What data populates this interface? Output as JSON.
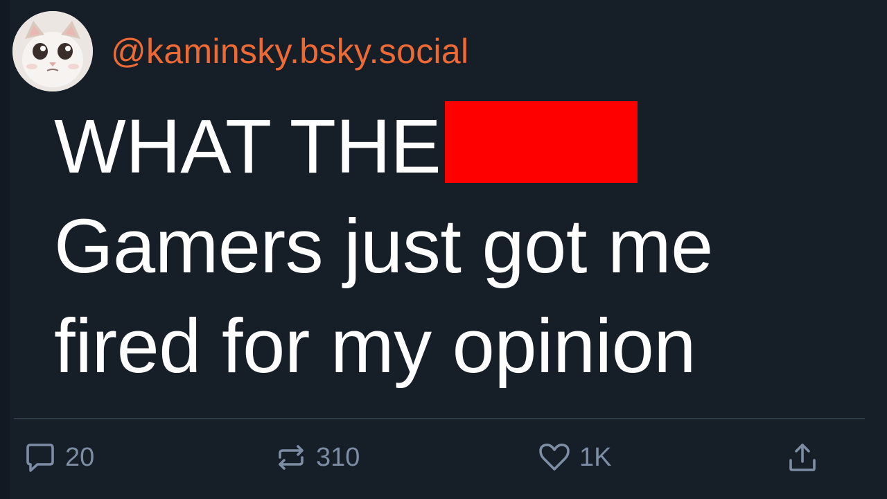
{
  "post": {
    "handle": "@kaminsky.bsky.social",
    "text_lines": [
      "WHAT THE",
      "Gamers just got me",
      "ﬁred for my opinion"
    ],
    "censor_color": "#ff0000"
  },
  "actions": {
    "reply": {
      "icon": "comment-icon",
      "count": "20"
    },
    "repost": {
      "icon": "repost-icon",
      "count": "310"
    },
    "like": {
      "icon": "heart-icon",
      "count": "1K"
    },
    "share": {
      "icon": "share-icon"
    }
  },
  "colors": {
    "background": "#161e28",
    "handle": "#ee6a34",
    "text": "#ffffff",
    "action": "#7d8ea4",
    "divider": "#303b48"
  }
}
